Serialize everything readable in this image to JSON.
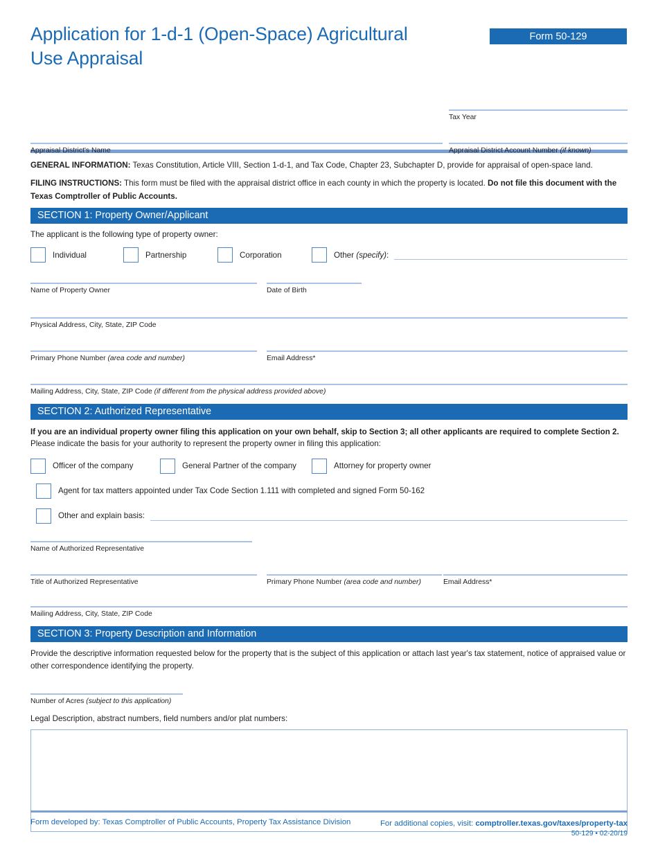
{
  "header": {
    "title_line1": "Application for 1-d-1 (Open-Space) Agricultural",
    "title_line2": "Use Appraisal",
    "form_badge": "Form 50-129"
  },
  "top_fields": {
    "tax_year_label": "Tax Year",
    "appraisal_district_name_label": "Appraisal District's Name",
    "account_number_label": "Appraisal District Account Number ",
    "account_number_label_italic": "(if known)"
  },
  "general_info": {
    "general_label": "GENERAL INFORMATION:",
    "general_text": " Texas Constitution, Article VIII, Section 1-d-1, and Tax Code, Chapter 23, Subchapter D, provide for appraisal of open-space land.",
    "filing_label": "FILING INSTRUCTIONS:",
    "filing_text": " This form must be filed with the appraisal district office in each county in which the property is located. ",
    "filing_bold_tail": "Do not file this document with the Texas Comptroller of Public Accounts."
  },
  "section1": {
    "heading": "SECTION 1: Property Owner/Applicant",
    "intro": "The applicant is the following type of property owner:",
    "owner_types": [
      {
        "label": "Individual"
      },
      {
        "label": "Partnership"
      },
      {
        "label": "Corporation"
      }
    ],
    "other_label": "Other ",
    "other_italic": "(specify)",
    "other_colon": ":",
    "fields": {
      "name_of_property_owner": "Name of Property Owner",
      "date_of_birth": "Date of Birth",
      "physical_address": "Physical Address, City, State, ZIP Code",
      "primary_phone": "Primary Phone Number ",
      "primary_phone_italic": "(area code and number)",
      "email": "Email Address*",
      "mailing_address": "Mailing Address, City, State, ZIP Code ",
      "mailing_address_italic": "(if different from the physical address provided above)"
    }
  },
  "section2": {
    "heading": "SECTION 2: Authorized Representative",
    "bold_note": "If you are an individual property owner filing this application on your own behalf, skip to Section 3; all other applicants are required to complete Section 2.",
    "intro": "Please indicate the basis for your authority to represent the property owner in filing this application:",
    "basis_options": [
      {
        "label": "Officer of the company"
      },
      {
        "label": "General Partner of the company"
      },
      {
        "label": "Attorney for property owner"
      }
    ],
    "agent_option": "Agent for tax matters appointed under Tax Code Section 1.111 with completed and signed Form 50-162",
    "other_option": "Other and explain basis:",
    "fields": {
      "name_of_rep": "Name of Authorized Representative",
      "title_of_rep": "Title of Authorized Representative",
      "primary_phone": "Primary Phone Number ",
      "primary_phone_italic": "(area code and number)",
      "email": "Email Address*",
      "mailing_address": "Mailing Address, City, State, ZIP Code"
    }
  },
  "section3": {
    "heading": "SECTION 3: Property Description and Information",
    "paragraph": "Provide the descriptive information requested below for the property that is the subject of this application or attach last year's tax statement, notice of appraised value or other correspondence identifying the property.",
    "acres_label": "Number of Acres ",
    "acres_label_italic": "(subject to this application)",
    "legal_description_label": "Legal Description, abstract numbers, field numbers and/or plat numbers:"
  },
  "footer": {
    "developed_by": "Form developed by: Texas Comptroller of Public Accounts, Property Tax Assistance Division",
    "copies_prefix": "For additional copies, visit: ",
    "copies_url": "comptroller.texas.gov/taxes/property-tax",
    "version": "50-129 • 02-20/19"
  },
  "colors": {
    "brand_blue": "#1b6ab4",
    "rule_blue": "#7a9fd4",
    "field_line_blue": "#a8c2e4",
    "checkbox_border": "#4f85c6"
  }
}
